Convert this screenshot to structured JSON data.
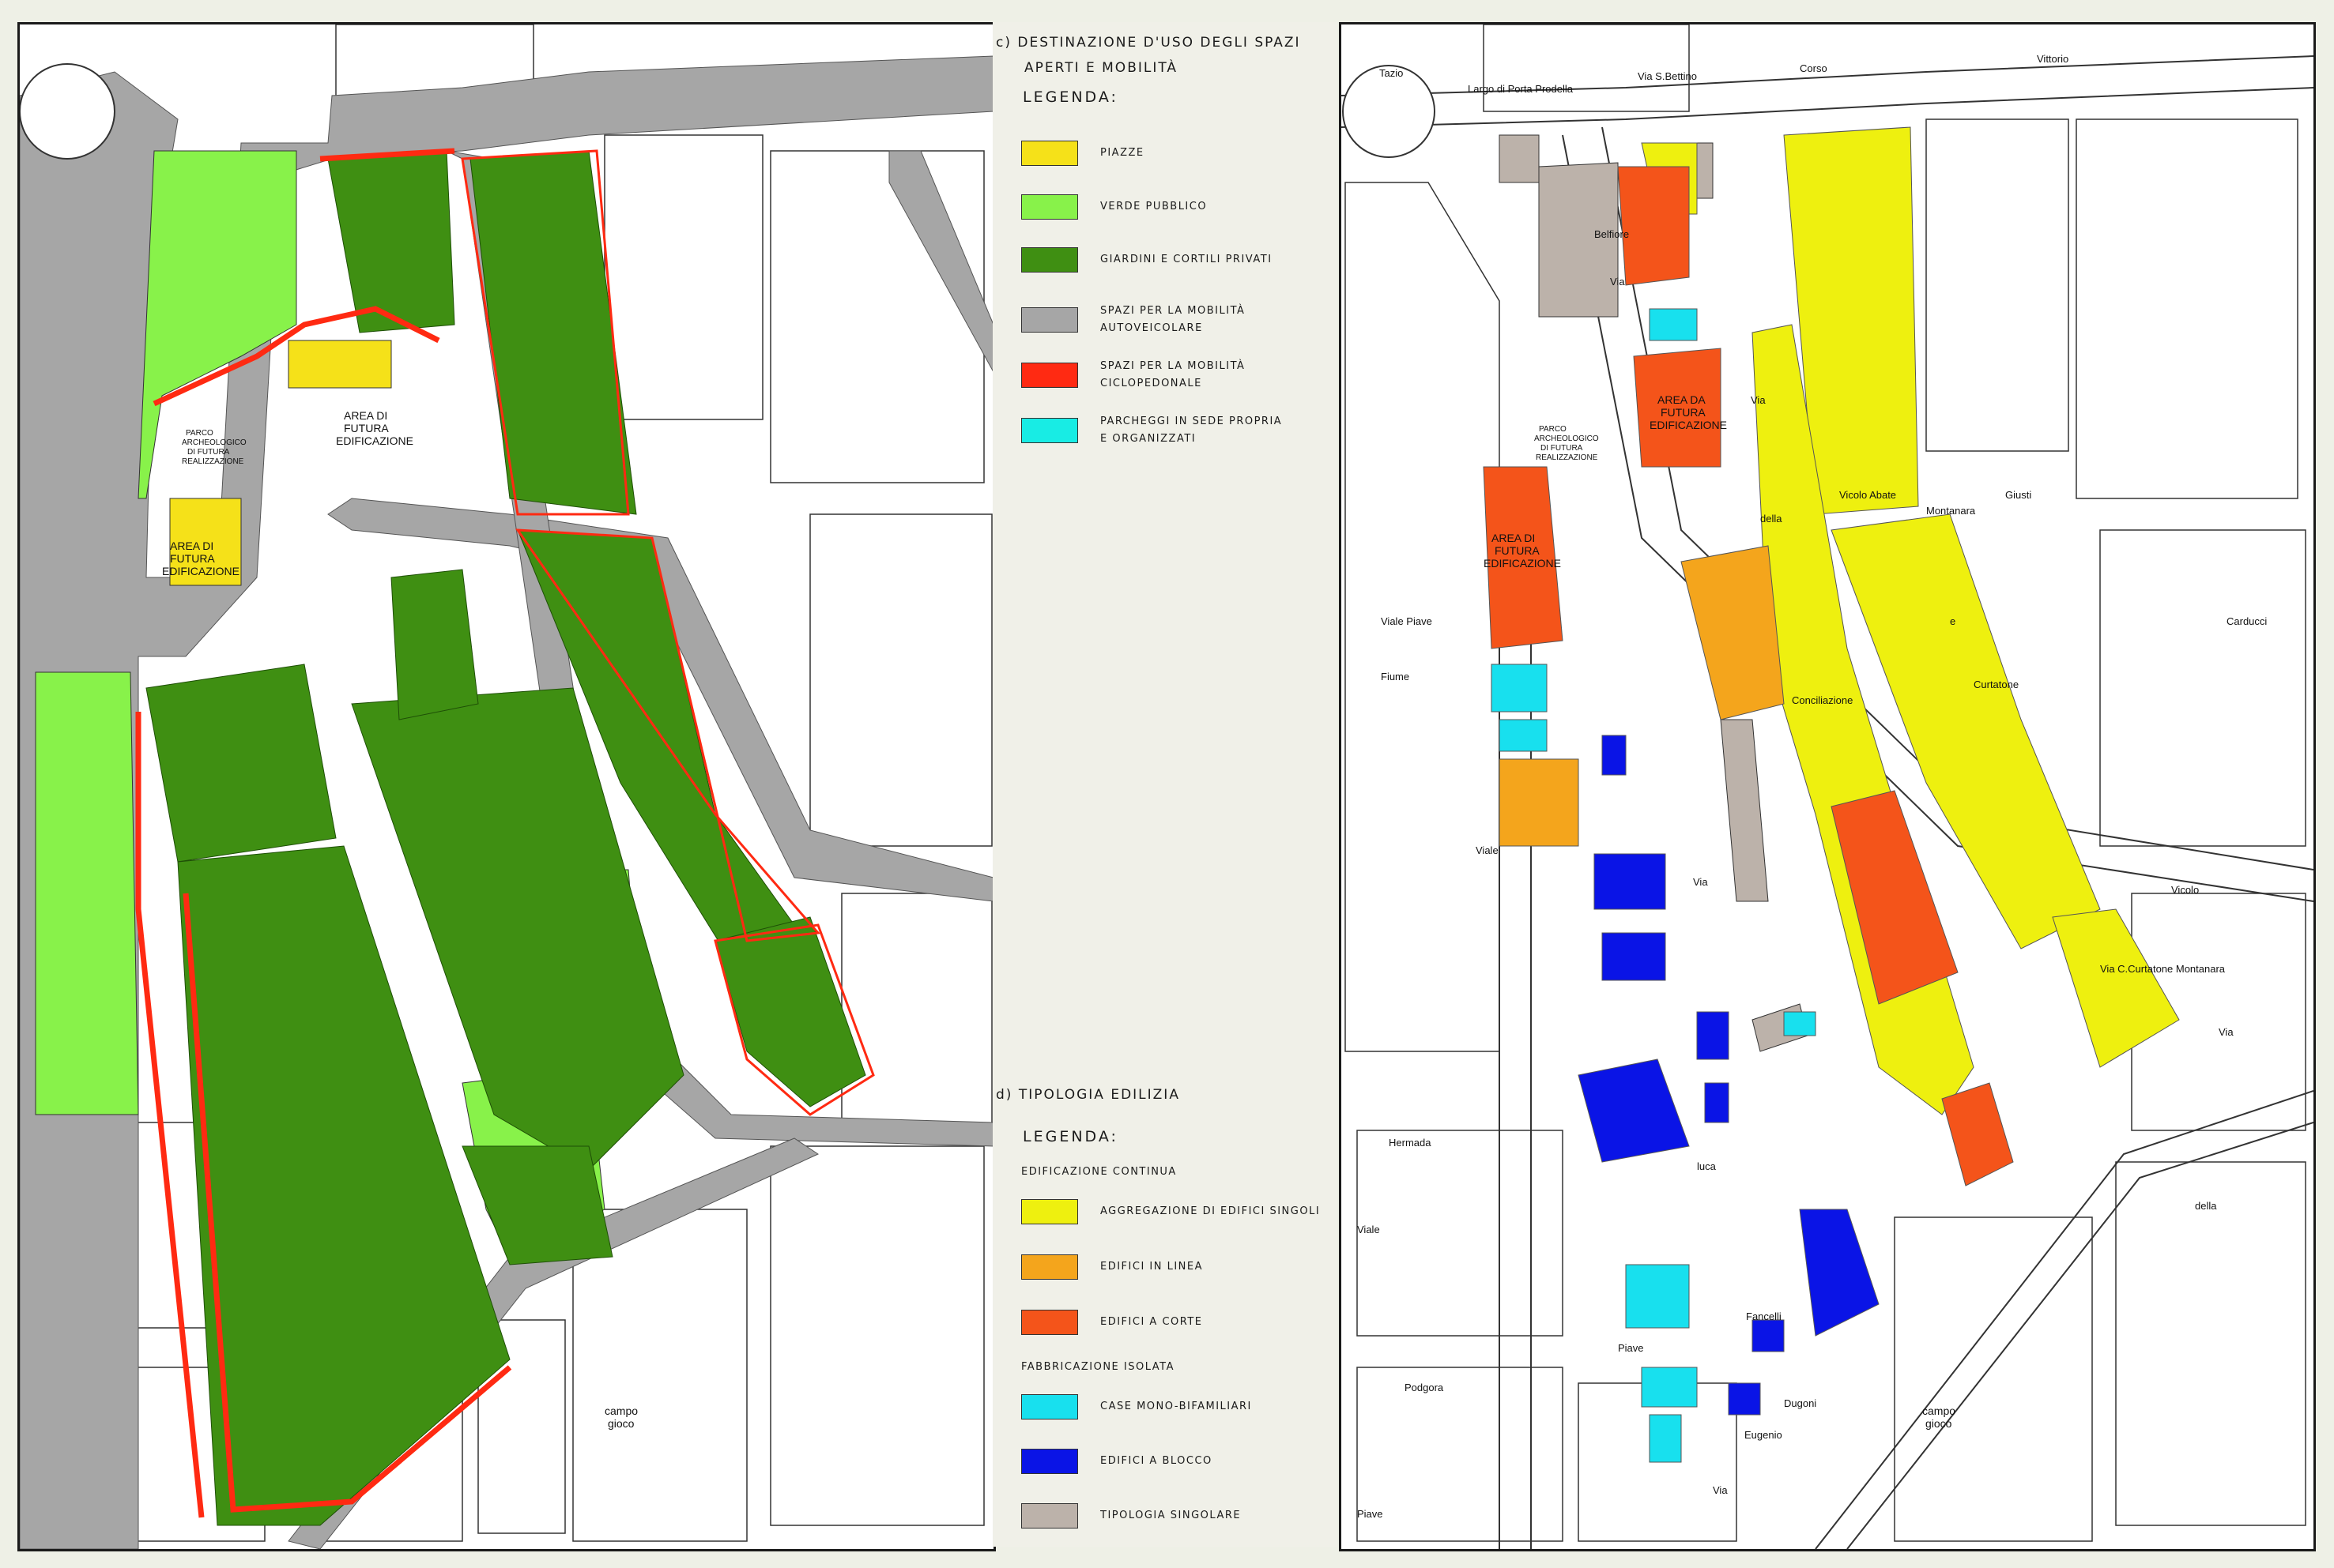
{
  "legend_c": {
    "title_line1": "c) DESTINAZIONE D'USO DEGLI SPAZI",
    "title_line2": "APERTI E MOBILITÀ",
    "heading": "LEGENDA:",
    "items": [
      {
        "label_lines": [
          "PIAZZE"
        ],
        "color": "#f5e119"
      },
      {
        "label_lines": [
          "VERDE PUBBLICO"
        ],
        "color": "#88f24a"
      },
      {
        "label_lines": [
          "GIARDINI E CORTILI PRIVATI"
        ],
        "color": "#3f8f12"
      },
      {
        "label_lines": [
          "SPAZI PER LA MOBILITÀ",
          "AUTOVEICOLARE"
        ],
        "color": "#a6a6a6"
      },
      {
        "label_lines": [
          "SPAZI PER LA MOBILITÀ",
          "CICLOPEDONALE"
        ],
        "color": "#ff2a12"
      },
      {
        "label_lines": [
          "PARCHEGGI IN SEDE PROPRIA",
          "E ORGANIZZATI"
        ],
        "color": "#18ece4"
      }
    ]
  },
  "legend_d": {
    "title": "d) TIPOLOGIA EDILIZIA",
    "heading": "LEGENDA:",
    "group1": "EDIFICAZIONE CONTINUA",
    "group2": "FABBRICAZIONE ISOLATA",
    "items": [
      {
        "label_lines": [
          "AGGREGAZIONE DI EDIFICI SINGOLI"
        ],
        "color": "#eef00f"
      },
      {
        "label_lines": [
          "EDIFICI IN LINEA"
        ],
        "color": "#f4a51c"
      },
      {
        "label_lines": [
          "EDIFICI A CORTE"
        ],
        "color": "#f4541a"
      },
      {
        "label_lines": [
          "CASE MONO-BIFAMILIARI"
        ],
        "color": "#18e0ee"
      },
      {
        "label_lines": [
          "EDIFICI A BLOCCO"
        ],
        "color": "#0a14e6"
      },
      {
        "label_lines": [
          "TIPOLOGIA SINGOLARE"
        ],
        "color": "#bcb2aa"
      }
    ]
  },
  "map_left": {
    "labels": {
      "parco_1": "PARCO",
      "parco_2": "ARCHEOLOGICO",
      "parco_3": "DI FUTURA",
      "parco_4": "REALIZZAZIONE",
      "area1_1": "AREA DI",
      "area1_2": "FUTURA",
      "area1_3": "EDIFICAZIONE",
      "area2_1": "AREA DI",
      "area2_2": "FUTURA",
      "area2_3": "EDIFICAZIONE",
      "campo_1": "campo",
      "campo_2": "gioco"
    }
  },
  "map_right": {
    "labels": {
      "parco_1": "PARCO",
      "parco_2": "ARCHEOLOGICO",
      "parco_3": "DI FUTURA",
      "parco_4": "REALIZZAZIONE",
      "area1_1": "AREA DA",
      "area1_2": "FUTURA",
      "area1_3": "EDIFICAZIONE",
      "area2_1": "AREA DI",
      "area2_2": "FUTURA",
      "area2_3": "EDIFICAZIONE",
      "campo_1": "campo",
      "campo_2": "gioco"
    },
    "streets": {
      "tazio": "Tazio",
      "largo": "Largo di Porta Prodella",
      "corso": "Corso",
      "vittorio": "Vittorio",
      "via_sbettino": "Via S.Bettino",
      "belfiore": "Belfiore",
      "via_belfiore": "Via",
      "via_conc": "Via",
      "della": "della",
      "conciliazione": "Conciliazione",
      "vicolo_abate": "Vicolo Abate",
      "montanara": "Montanara",
      "e": "e",
      "curtatone": "Curtatone",
      "giusti": "Giusti",
      "carducci": "Carducci",
      "viale_piave": "Viale Piave",
      "fiume": "Fiume",
      "viale": "Viale",
      "via_luca": "Via",
      "luca": "luca",
      "fancelli": "Fancelli",
      "hermada": "Hermada",
      "viale2": "Viale",
      "piave": "Piave",
      "podgora": "Podgora",
      "piave2": "Piave",
      "eugenio": "Eugenio",
      "dugoni": "Dugoni",
      "via_bottom": "Via",
      "via_cm": "Via C.Curtatone Montanara",
      "vicolo": "Vicolo",
      "della_r": "della",
      "via_r": "Via"
    }
  }
}
